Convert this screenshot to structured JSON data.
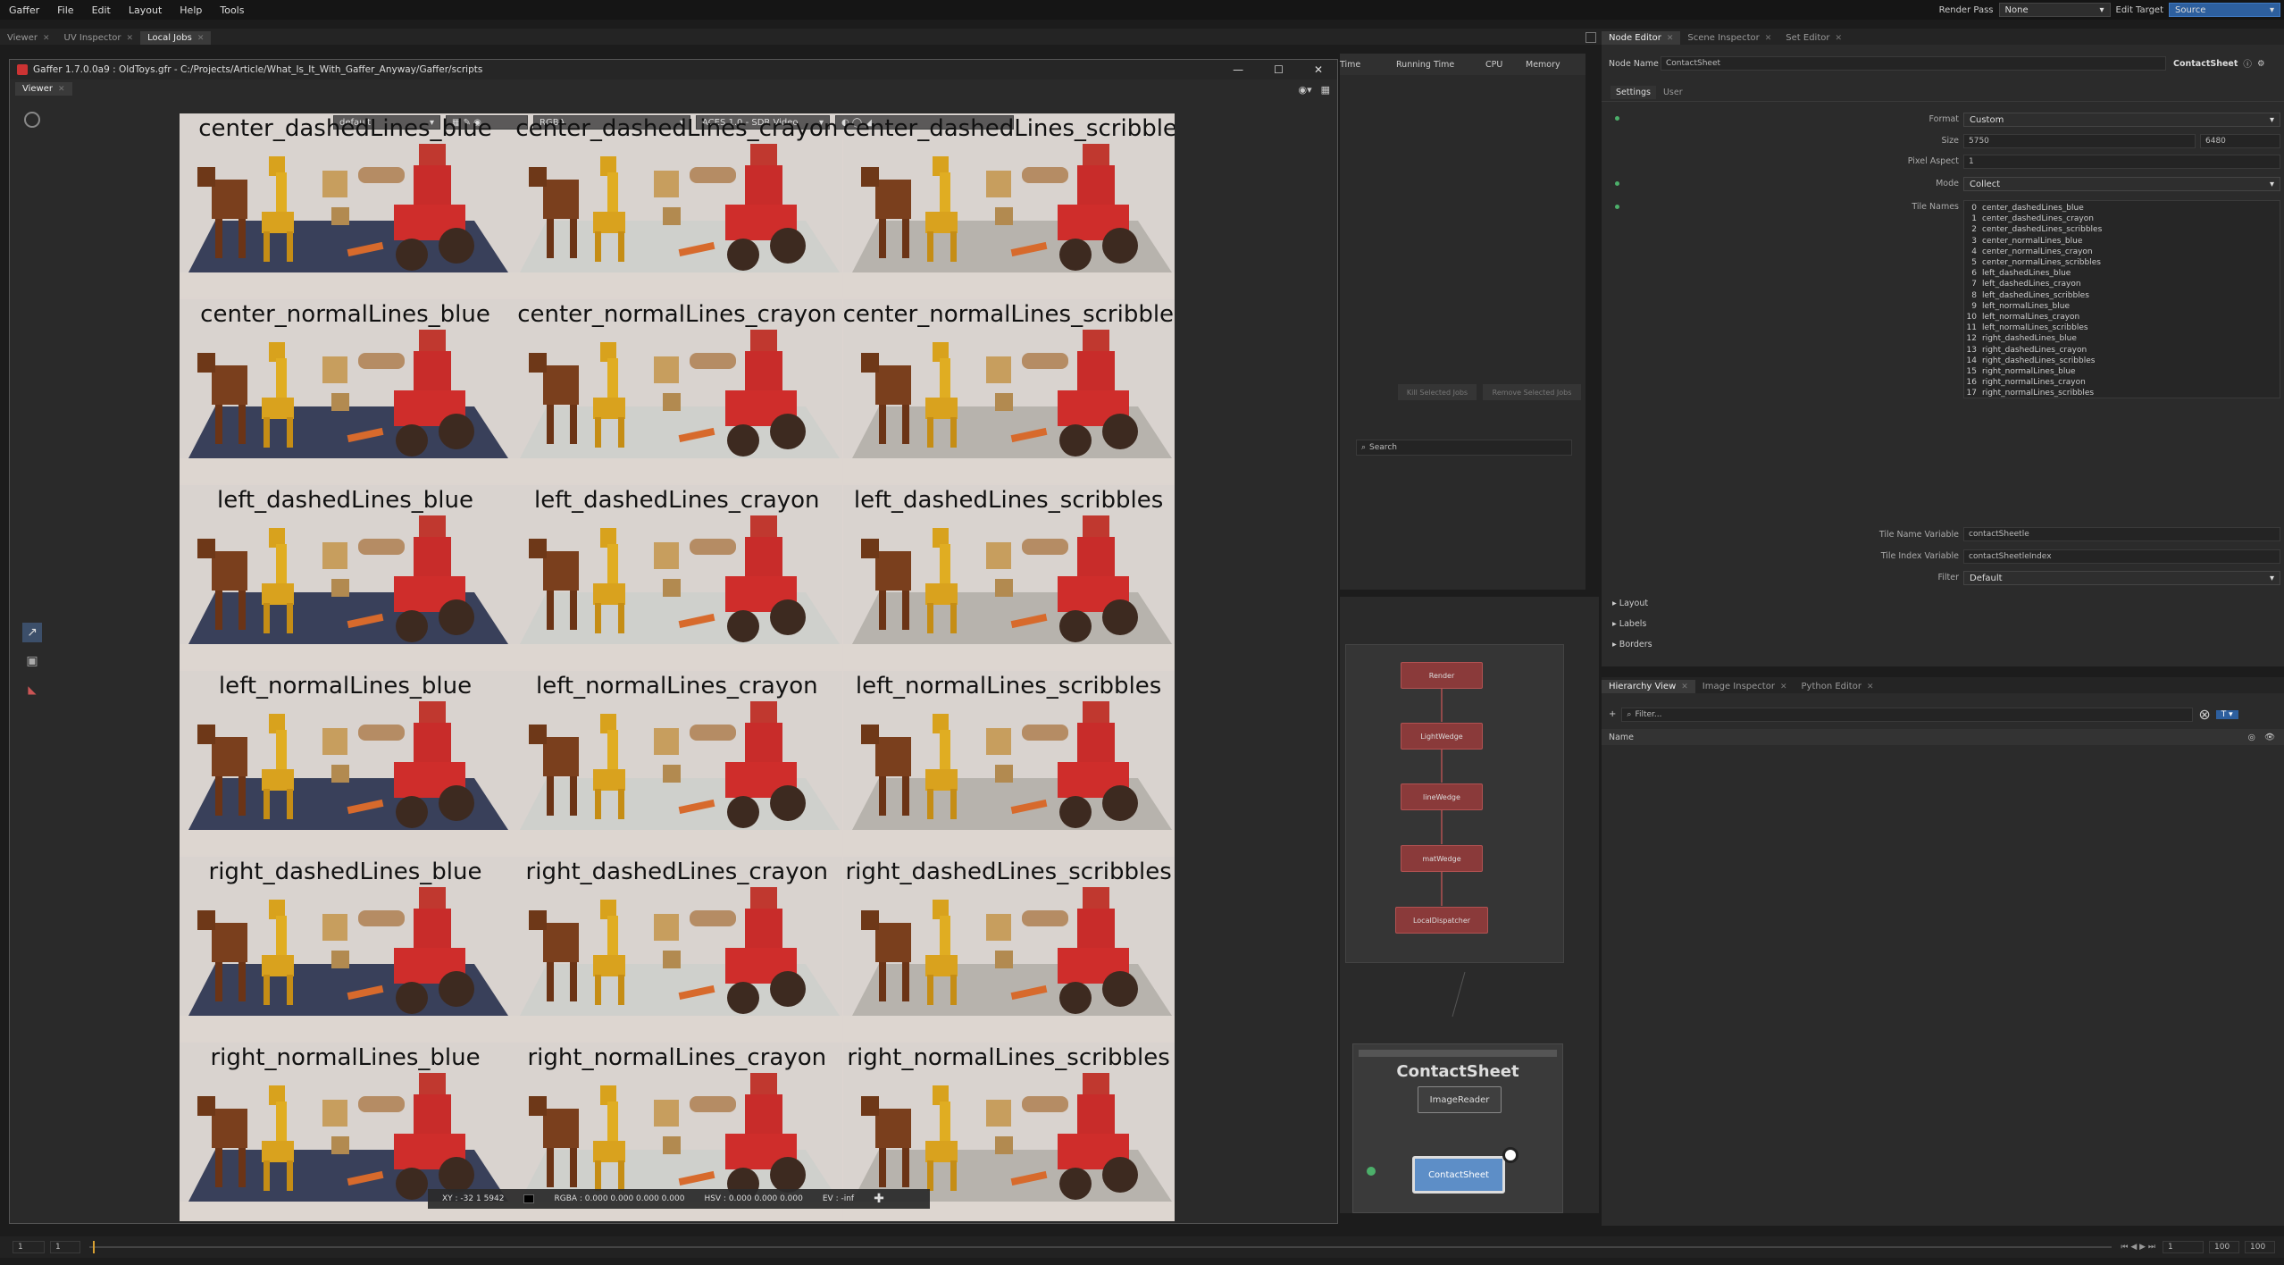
{
  "menubar": {
    "items": [
      "Gaffer",
      "File",
      "Edit",
      "Layout",
      "Help",
      "Tools"
    ],
    "render_pass_label": "Render Pass",
    "render_pass_value": "None",
    "edit_target_label": "Edit Target",
    "edit_target_value": "Source"
  },
  "left_tabs": [
    {
      "label": "Viewer"
    },
    {
      "label": "UV Inspector"
    },
    {
      "label": "Local Jobs"
    }
  ],
  "window": {
    "title": "Gaffer 1.7.0.0a9 : OldToys.gfr - C:/Projects/Article/What_Is_It_With_Gaffer_Anyway/Gaffer/scripts",
    "viewer_tab": "Viewer"
  },
  "viewer_toolbar": {
    "display": "default",
    "channels": "RGBA",
    "color": "ACES 1.0 - SDR Video"
  },
  "tiles": [
    "center_dashedLines_blue",
    "center_dashedLines_crayon",
    "center_dashedLines_scribbles",
    "center_normalLines_blue",
    "center_normalLines_crayon",
    "center_normalLines_scribbles",
    "left_dashedLines_blue",
    "left_dashedLines_crayon",
    "left_dashedLines_scribbles",
    "left_normalLines_blue",
    "left_normalLines_crayon",
    "left_normalLines_scribbles",
    "right_dashedLines_blue",
    "right_dashedLines_crayon",
    "right_dashedLines_scribbles",
    "right_normalLines_blue",
    "right_normalLines_crayon",
    "right_normalLines_scribbles"
  ],
  "status_bar": {
    "xy": "XY : -32 1 5942",
    "rgba": "RGBA : 0.000 0.000 0.000 0.000",
    "hsv": "HSV : 0.000 0.000 0.000",
    "ev": "EV : -inf"
  },
  "jobs": {
    "columns": [
      "Time",
      "Running Time",
      "CPU",
      "Memory"
    ],
    "kill_button": "Kill Selected Jobs",
    "remove_button": "Remove Selected Jobs",
    "search_placeholder": "Search"
  },
  "graph": {
    "nodes": [
      "Render",
      "LightWedge",
      "lineWedge",
      "matWedge",
      "LocalDispatcher"
    ],
    "box_title": "ContactSheet",
    "image_reader": "ImageReader",
    "contact_sheet": "ContactSheet"
  },
  "node_editor": {
    "tabs": [
      "Node Editor",
      "Scene Inspector",
      "Set Editor"
    ],
    "node_name_label": "Node Name",
    "node_name": "ContactSheet",
    "node_type": "ContactSheet",
    "sub_tabs": [
      "Settings",
      "User"
    ],
    "format_label": "Format",
    "format": "Custom",
    "size_label": "Size",
    "size_w": "5750",
    "size_h": "6480",
    "pixel_aspect_label": "Pixel Aspect",
    "pixel_aspect": "1",
    "mode_label": "Mode",
    "mode": "Collect",
    "tile_names_label": "Tile Names",
    "tile_name_var_label": "Tile Name Variable",
    "tile_name_var": "contactSheetle",
    "tile_index_var_label": "Tile Index Variable",
    "tile_index_var": "contactSheetleIndex",
    "filter_label": "Filter",
    "filter": "Default",
    "sections": [
      "Layout",
      "Labels",
      "Borders"
    ]
  },
  "hierarchy": {
    "tabs": [
      "Hierarchy View",
      "Image Inspector",
      "Python Editor"
    ],
    "filter_placeholder": "Filter...",
    "name_header": "Name"
  },
  "timeline": {
    "start": "1",
    "current": "1",
    "end": "100",
    "end2": "100"
  }
}
